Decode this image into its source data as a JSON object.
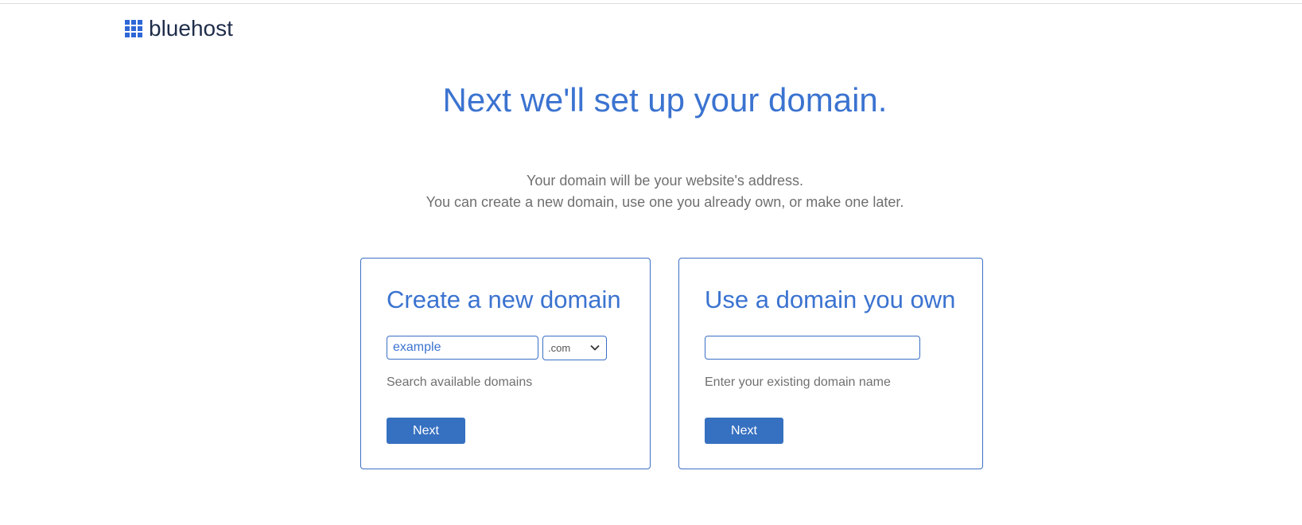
{
  "brand": {
    "name": "bluehost",
    "logo_icon": "grid-icon",
    "accent": "#2e67d6"
  },
  "header": {
    "title": "Next we'll set up your domain."
  },
  "intro": {
    "line1": "Your domain will be your website's address.",
    "line2": "You can create a new domain, use one you already own, or make one later."
  },
  "create_card": {
    "title": "Create a new domain",
    "input_value": "example",
    "tld_selected": ".com",
    "helper": "Search available domains",
    "button_label": "Next"
  },
  "own_card": {
    "title": "Use a domain you own",
    "input_value": "",
    "helper": "Enter your existing domain name",
    "button_label": "Next"
  },
  "colors": {
    "title_blue": "#3b73d0",
    "button_blue": "#3670c0",
    "border_blue": "#3b6fc4"
  }
}
